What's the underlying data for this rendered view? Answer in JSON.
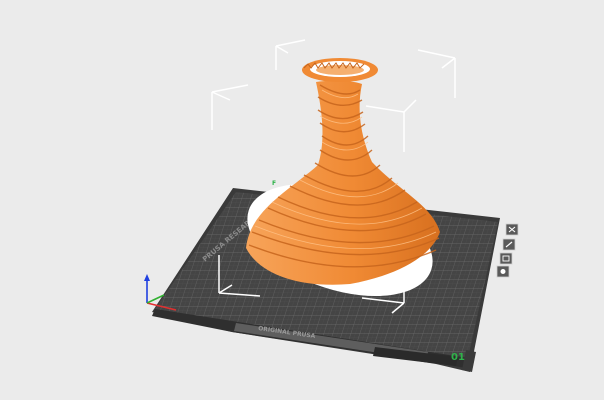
{
  "scene": {
    "background": "#ebebeb",
    "plate_color": "#454545",
    "grid_color": "#6c6c6c",
    "model_color": "#f28c37",
    "model_shadow": "#c7651d",
    "bbox_color": "#ffffff",
    "axis_colors": {
      "x": "#e03030",
      "y": "#30b030",
      "z": "#2040e0"
    }
  },
  "plate": {
    "label_corner": "01",
    "label_back": "F",
    "side_text": "PRUSA RESEARCH",
    "bottom_text": "ORIGINAL PRUSA"
  },
  "tools": [
    {
      "name": "tool-close",
      "icon": "close-icon"
    },
    {
      "name": "tool-edit",
      "icon": "edit-icon"
    },
    {
      "name": "tool-layers",
      "icon": "layers-icon"
    },
    {
      "name": "tool-arrange",
      "icon": "arrange-icon"
    }
  ]
}
